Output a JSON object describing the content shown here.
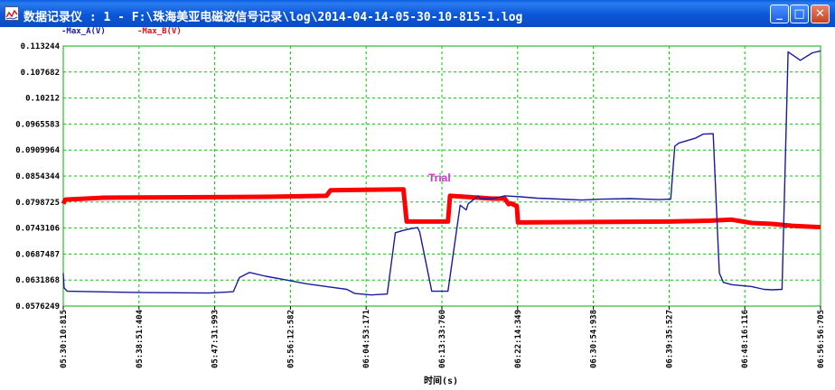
{
  "window": {
    "title": "数据记录仪 : 1 - F:\\珠海美亚电磁波信号记录\\log\\2014-04-14-05-30-10-815-1.log",
    "minimize_glyph": "_",
    "maximize_glyph": "□",
    "close_glyph": "✕"
  },
  "legend": {
    "a_label": "-Max_A(V)",
    "b_label": "-Max_B(V)",
    "a_color": "#1a1aa0",
    "b_color": "#ff0000"
  },
  "annotation": {
    "text": "Trial",
    "color": "#cc33cc"
  },
  "chart_data": {
    "type": "line",
    "xlabel": "时间(s)",
    "ylabel": "",
    "x_tick_labels": [
      "05:30:10:815",
      "05:38:51:404",
      "05:47:31:993",
      "05:56:12:582",
      "06:04:53:171",
      "06:13:33:760",
      "06:22:14:349",
      "06:30:54:938",
      "06:39:35:527",
      "06:48:16:116",
      "06:56:56:705"
    ],
    "y_tick_labels": [
      "0.113244",
      "0.107682",
      "0.10212",
      "0.0965583",
      "0.0909964",
      "0.0854344",
      "0.0798725",
      "0.0743106",
      "0.0687487",
      "0.0631868",
      "0.0576249"
    ],
    "ylim": [
      0.0576249,
      0.113244
    ],
    "grid": true,
    "grid_color": "#00c800",
    "legend_position": "top-left",
    "x_unit": "minutes since 05:30:10",
    "series": [
      {
        "name": "Max_A(V)",
        "color": "#1a1aa0",
        "x": [
          0,
          0.2,
          1,
          20,
          36,
          42,
          43.5,
          46,
          50,
          55,
          60,
          65,
          70,
          72,
          76,
          80,
          82,
          84,
          86,
          87.5,
          88,
          91,
          95,
          98,
          99.5,
          100,
          102.5,
          103,
          106,
          107.5,
          109,
          113,
          117,
          120,
          128,
          133,
          140,
          147,
          150,
          151,
          152,
          156,
          158,
          160.5,
          162,
          163,
          165,
          170,
          173,
          175,
          177.5,
          179,
          182,
          185,
          187
        ],
        "y": [
          0.0647,
          0.0615,
          0.0608,
          0.0605,
          0.0604,
          0.0607,
          0.0637,
          0.0648,
          0.064,
          0.0632,
          0.0624,
          0.0618,
          0.0612,
          0.0603,
          0.06,
          0.0602,
          0.0733,
          0.0738,
          0.0742,
          0.0744,
          0.0735,
          0.0608,
          0.0608,
          0.0792,
          0.0782,
          0.0795,
          0.0812,
          0.0806,
          0.0806,
          0.0809,
          0.0812,
          0.081,
          0.0807,
          0.0806,
          0.0803,
          0.0805,
          0.0806,
          0.0804,
          0.0805,
          0.0918,
          0.0925,
          0.0935,
          0.0944,
          0.0945,
          0.0647,
          0.0627,
          0.0622,
          0.0618,
          0.0612,
          0.0611,
          0.0612,
          0.112,
          0.1102,
          0.1118,
          0.1122
        ]
      },
      {
        "name": "Max_B(V)",
        "color": "#ff0000",
        "x": [
          0,
          0.5,
          10,
          30,
          50,
          65,
          66,
          84,
          84.8,
          95,
          95.5,
          106,
          109,
          110,
          110.5,
          112,
          112.3,
          130,
          150,
          160,
          165,
          170,
          175,
          180,
          187
        ],
        "y": [
          0.0795,
          0.0804,
          0.0808,
          0.0809,
          0.081,
          0.0812,
          0.0824,
          0.0826,
          0.0757,
          0.0757,
          0.0812,
          0.0806,
          0.0806,
          0.0794,
          0.0796,
          0.079,
          0.0755,
          0.0756,
          0.0757,
          0.0759,
          0.0761,
          0.0754,
          0.0752,
          0.0748,
          0.0745
        ]
      }
    ]
  }
}
